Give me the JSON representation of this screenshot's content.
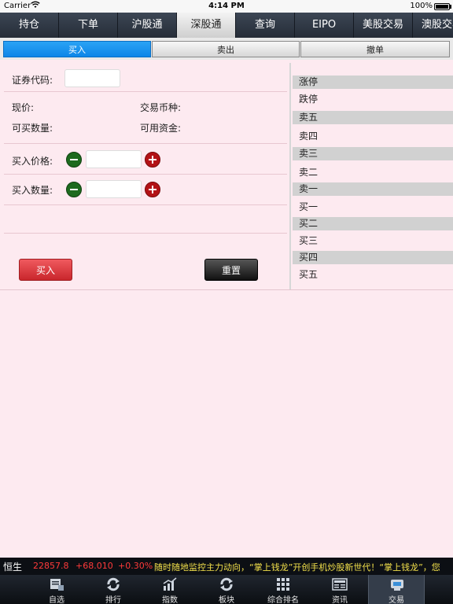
{
  "status_bar": {
    "carrier": "Carrier",
    "time": "4:14 PM",
    "battery": "100%"
  },
  "top_tabs": [
    "持仓",
    "下单",
    "沪股通",
    "深股通",
    "查询",
    "EIPO",
    "美股交易",
    "澳股交易"
  ],
  "top_tab_active": "深股通",
  "segments": {
    "buy": "买入",
    "sell": "卖出",
    "cancel": "撤单",
    "active": "买入"
  },
  "form": {
    "code_label": "证券代码:",
    "code_value": "",
    "price_now_label": "现价:",
    "currency_label": "交易币种:",
    "buyable_qty_label": "可买数量:",
    "available_funds_label": "可用资金:",
    "buy_price_label": "买入价格:",
    "buy_price_value": "",
    "buy_qty_label": "买入数量:",
    "buy_qty_value": "",
    "buy_button": "买入",
    "reset_button": "重置"
  },
  "quote_list": [
    {
      "label": "涨停",
      "grey": true
    },
    {
      "label": "跌停",
      "grey": false
    },
    {
      "label": "卖五",
      "grey": true
    },
    {
      "label": "卖四",
      "grey": false
    },
    {
      "label": "卖三",
      "grey": true
    },
    {
      "label": "卖二",
      "grey": false
    },
    {
      "label": "卖一",
      "grey": true
    },
    {
      "label": "买一",
      "grey": false
    },
    {
      "label": "买二",
      "grey": true
    },
    {
      "label": "买三",
      "grey": false
    },
    {
      "label": "买四",
      "grey": true
    },
    {
      "label": "买五",
      "grey": false
    }
  ],
  "ticker": {
    "index_name": "恒生",
    "index_value": "22857.8",
    "change": "+68.010",
    "change_pct": "+0.30%",
    "marquee": "随时随地监控主力动向，“掌上钱龙”开创手机炒股新世代！“掌上钱龙”，您"
  },
  "bottom_tabs": [
    {
      "label": "自选",
      "icon": "portfolio-icon"
    },
    {
      "label": "排行",
      "icon": "refresh-arrows-icon"
    },
    {
      "label": "指数",
      "icon": "bar-chart-icon"
    },
    {
      "label": "板块",
      "icon": "refresh-arrows-icon"
    },
    {
      "label": "综合排名",
      "icon": "grid-icon"
    },
    {
      "label": "资讯",
      "icon": "newspaper-icon"
    },
    {
      "label": "交易",
      "icon": "trade-icon"
    }
  ],
  "bottom_tab_active": "交易",
  "colors": {
    "accent_blue": "#0d86e8",
    "buy_red": "#c9262c",
    "plus_red": "#b31216",
    "minus_green": "#1d6a1e",
    "background_pink": "#fdeaf0"
  }
}
